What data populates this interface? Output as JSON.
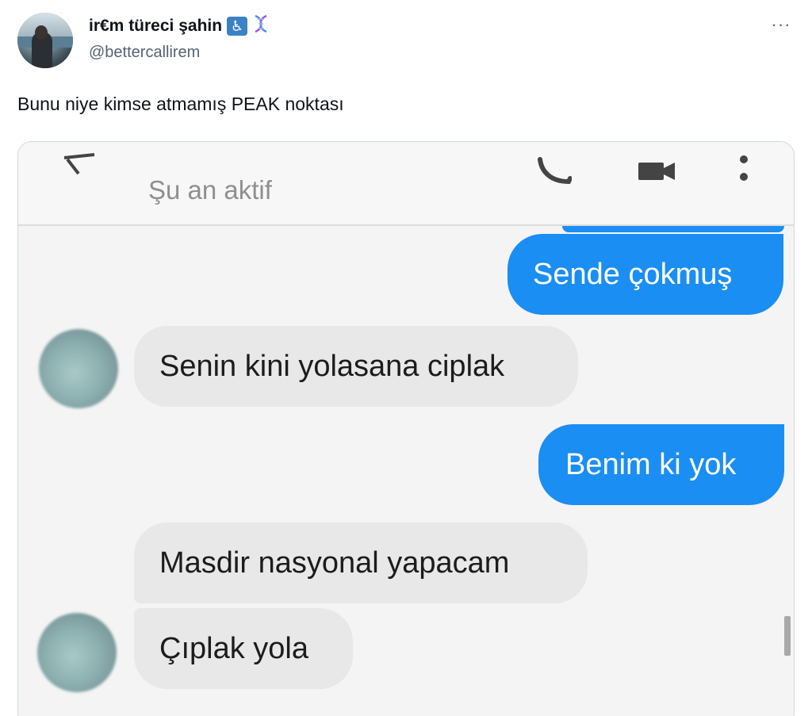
{
  "tweet": {
    "display_name": "ir€m türeci şahin",
    "badges": [
      "wheelchair-emoji",
      "dna-emoji"
    ],
    "wheelchair_glyph": "♿",
    "dna_glyph": "🧬",
    "handle": "@bettercallirem",
    "more_glyph": "···",
    "text": "Bunu niye kimse atmamış PEAK noktası"
  },
  "chat": {
    "status": "Şu an aktif",
    "messages": [
      {
        "direction": "outgoing",
        "text": "Sende çokmuş"
      },
      {
        "direction": "incoming",
        "text": "Senin kini yolasana ciplak"
      },
      {
        "direction": "outgoing",
        "text": "Benim ki yok"
      },
      {
        "direction": "incoming",
        "text": "Masdir nasyonal yapacam"
      },
      {
        "direction": "incoming",
        "text": "Çıplak yola"
      }
    ]
  },
  "colors": {
    "outgoing_bubble": "#1a8ef2",
    "incoming_bubble": "#e8e8e8",
    "handle_gray": "#536471"
  }
}
